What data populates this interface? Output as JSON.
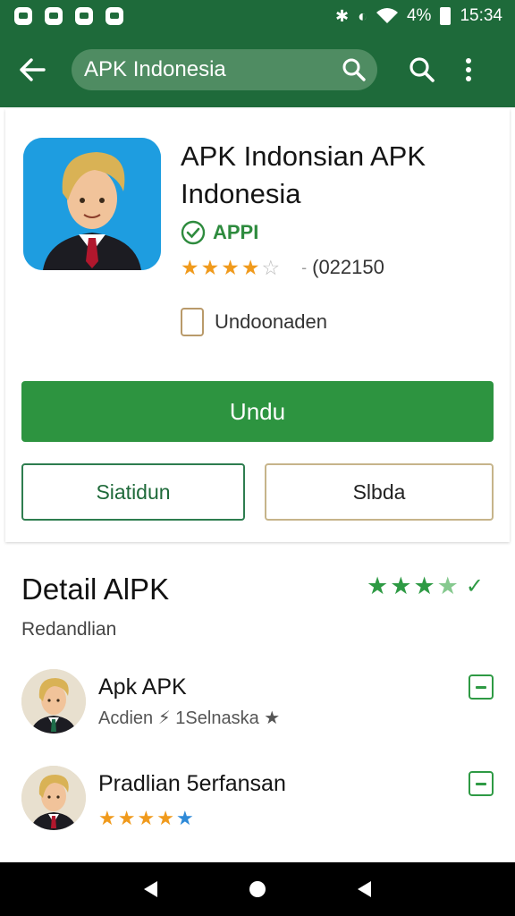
{
  "status_bar": {
    "icons_left": [
      "notification-icon",
      "gallery-icon",
      "mail-icon",
      "shield-icon"
    ],
    "bluetooth": "✱",
    "battery_percent": "4%",
    "time": "15:34"
  },
  "app_bar": {
    "search_text": "APK Indonesia"
  },
  "app": {
    "title": "APK Indonsian APK Indonesia",
    "badge": "APPI",
    "rating": 4.5,
    "rating_count": "(022150",
    "checkbox_label": "Undoonaden"
  },
  "buttons": {
    "primary": "Undu",
    "secondary_1": "Siatidun",
    "secondary_2": "Slbda"
  },
  "details": {
    "title": "Detail AlPK",
    "subtitle": "Redandlian",
    "stars": 3.5
  },
  "list": [
    {
      "title": "Apk APK",
      "subtitle": "Acdien ⚡ 1Selnaska ★"
    },
    {
      "title": "Pradlian 5erfansan",
      "stars": 5
    }
  ],
  "colors": {
    "primary_green": "#2d9440",
    "dark_green": "#1e6a3a",
    "star_orange": "#f09a1c"
  }
}
